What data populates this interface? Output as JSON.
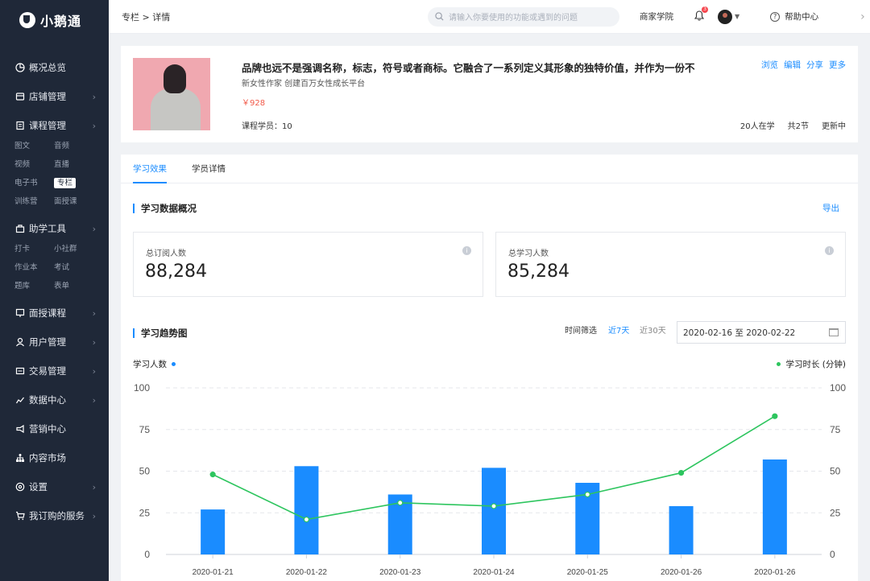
{
  "app": {
    "logo_text": "小鹅通"
  },
  "sidebar": {
    "items": [
      {
        "label": "概况总览",
        "icon": "pie-chart-icon",
        "arrow": false
      },
      {
        "label": "店铺管理",
        "icon": "store-icon",
        "arrow": true
      },
      {
        "label": "课程管理",
        "icon": "course-book-icon",
        "arrow": true,
        "sub": [
          "图文",
          "音频",
          "视频",
          "直播",
          "电子书",
          "专栏",
          "训练营",
          "面授课"
        ],
        "active_sub": "专栏"
      },
      {
        "label": "助学工具",
        "icon": "toolbox-icon",
        "arrow": true,
        "sub": [
          "打卡",
          "小社群",
          "作业本",
          "考试",
          "题库",
          "表单"
        ]
      },
      {
        "label": "面授课程",
        "icon": "classroom-icon",
        "arrow": true
      },
      {
        "label": "用户管理",
        "icon": "user-icon",
        "arrow": true
      },
      {
        "label": "交易管理",
        "icon": "wallet-icon",
        "arrow": true
      },
      {
        "label": "数据中心",
        "icon": "line-chart-icon",
        "arrow": true
      },
      {
        "label": "营销中心",
        "icon": "megaphone-icon",
        "arrow": false
      },
      {
        "label": "内容市场",
        "icon": "org-tree-icon",
        "arrow": false
      },
      {
        "label": "设置",
        "icon": "settings-icon",
        "arrow": true
      },
      {
        "label": "我订购的服务",
        "icon": "cart-icon",
        "arrow": true
      }
    ]
  },
  "header": {
    "breadcrumb": "专栏 > 详情",
    "search_placeholder": "请输入你要使用的功能或遇到的问题",
    "academy": "商家学院",
    "notification_count": "3",
    "help": "帮助中心"
  },
  "course": {
    "title": "品牌也远不是强调名称，标志，符号或者商标。它融合了一系列定义其形象的独特价值，并作为一份不",
    "subtitle": "新女性作家 创建百万女性成长平台",
    "price": "￥928",
    "students": "课程学员：10",
    "actions": [
      "浏览",
      "编辑",
      "分享",
      "更多"
    ],
    "learning_now": "20人在学",
    "sections": "共2节",
    "status": "更新中"
  },
  "tabs": {
    "items": [
      "学习效果",
      "学员详情"
    ],
    "active": 0
  },
  "overview": {
    "title": "学习数据概况",
    "export": "导出",
    "stats": [
      {
        "label": "总订阅人数",
        "value": "88,284"
      },
      {
        "label": "总学习人数",
        "value": "85,284"
      }
    ]
  },
  "trend": {
    "title": "学习趋势图",
    "filter_label": "时间筛选",
    "filter_7": "近7天",
    "filter_30": "近30天",
    "date_range": "2020-02-16 至 2020-02-22",
    "legend_left": "学习人数",
    "legend_right": "学习时长 (分钟)"
  },
  "colors": {
    "accent": "#1a8cff",
    "line": "#2dc55e",
    "sidebar": "#1f2838"
  },
  "chart_data": {
    "type": "bar",
    "categories": [
      "2020-01-21",
      "2020-01-22",
      "2020-01-23",
      "2020-01-24",
      "2020-01-25",
      "2020-01-26",
      "2020-01-26"
    ],
    "series": [
      {
        "name": "学习人数",
        "type": "bar",
        "axis": "left",
        "values": [
          27,
          53,
          36,
          52,
          43,
          29,
          57
        ]
      },
      {
        "name": "学习时长 (分钟)",
        "type": "line",
        "axis": "right",
        "values": [
          48,
          21,
          31,
          29,
          36,
          49,
          83
        ]
      }
    ],
    "ylim": [
      0,
      100
    ],
    "yticks": [
      0,
      25,
      50,
      75,
      100
    ],
    "grid": true
  }
}
